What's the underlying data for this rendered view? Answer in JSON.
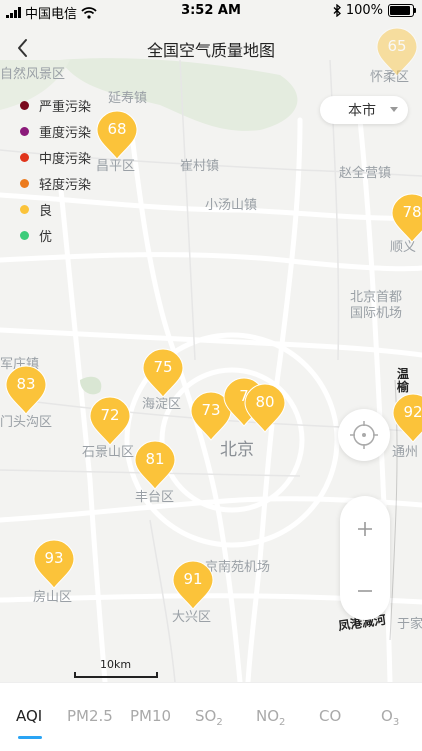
{
  "status_bar": {
    "carrier": "中国电信",
    "time": "3:52 AM",
    "battery": "100%",
    "battery_level": 1.0
  },
  "nav": {
    "title": "全国空气质量地图"
  },
  "legend": [
    {
      "label": "严重污染",
      "color": "#7a0a1e"
    },
    {
      "label": "重度污染",
      "color": "#8b1a7a"
    },
    {
      "label": "中度污染",
      "color": "#e0341b"
    },
    {
      "label": "轻度污染",
      "color": "#ec7b1e"
    },
    {
      "label": "良",
      "color": "#fbc33a"
    },
    {
      "label": "优",
      "color": "#3ccc7a"
    }
  ],
  "city_select": {
    "label": "本市"
  },
  "map_labels": {
    "yanshou": "延寿镇",
    "park": "自然风景区",
    "changping": "昌平区",
    "cuncun": "崔村镇",
    "zhaoquanying": "赵全营镇",
    "xiaotangshan": "小汤山镇",
    "shunyi": "顺义",
    "airport1": "北京首都",
    "airport2": "国际机场",
    "junzhuang": "军庄镇",
    "mentougou": "门头沟区",
    "haidian": "海淀区",
    "shijingshan": "石景山区",
    "beijing": "北京",
    "tongzhou": "通州",
    "fengtai": "丰台区",
    "fangshan": "房山区",
    "nanyuan": "京南苑机场",
    "daxing": "大兴区",
    "yujia": "于家",
    "wenyu": "温榆",
    "fenggang": "凤港减河",
    "top_right": "怀柔区"
  },
  "markers": [
    {
      "name": "marker-changping",
      "value": "68"
    },
    {
      "name": "marker-shunyi",
      "value": "78"
    },
    {
      "name": "marker-top-right",
      "value": "65"
    },
    {
      "name": "marker-mentougou",
      "value": "83"
    },
    {
      "name": "marker-haidian",
      "value": "75"
    },
    {
      "name": "marker-shijingshan",
      "value": "72"
    },
    {
      "name": "marker-dongcheng",
      "value": "73"
    },
    {
      "name": "marker-xicheng",
      "value": "7"
    },
    {
      "name": "marker-chaoyang",
      "value": "80"
    },
    {
      "name": "marker-tongzhou",
      "value": "92"
    },
    {
      "name": "marker-fengtai",
      "value": "81"
    },
    {
      "name": "marker-fangshan",
      "value": "93"
    },
    {
      "name": "marker-daxing",
      "value": "91"
    }
  ],
  "marker_color": "#fbc33a",
  "scale": {
    "label": "10km"
  },
  "zoom": {
    "plus": "+",
    "minus": "−"
  },
  "tabs": [
    {
      "label": "AQI",
      "active": true
    },
    {
      "label": "PM2.5"
    },
    {
      "label": "PM10"
    },
    {
      "label": "SO",
      "sub": "2"
    },
    {
      "label": "NO",
      "sub": "2"
    },
    {
      "label": "CO"
    },
    {
      "label": "O",
      "sub": "3"
    }
  ]
}
